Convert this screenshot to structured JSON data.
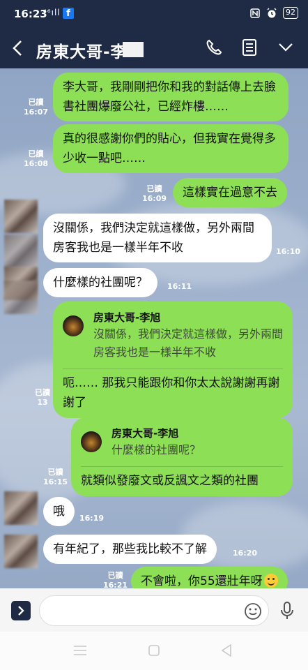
{
  "status_bar": {
    "time": "16:23",
    "signal": "⁴⁶ıll",
    "battery": "92",
    "icons": [
      "facebook-icon",
      "nfc-icon",
      "alarm-icon",
      "battery-icon"
    ]
  },
  "header": {
    "title": "房東大哥-李",
    "icons": [
      "back-arrow-icon",
      "phone-icon",
      "notes-icon",
      "chevron-down-icon"
    ],
    "background": "#1f2b45"
  },
  "chat": {
    "background": "#9db0cc",
    "outgoing_color": "#8de055",
    "incoming_color": "#ffffff",
    "messages": [
      {
        "dir": "out",
        "text": "李大哥，我剛剛把你和我的對話傳上去臉書社團爆廢公社，已經炸樓……",
        "read": "已讀",
        "time": "16:07"
      },
      {
        "dir": "out",
        "text": "真的很感謝你們的貼心，但我實在覺得多少收一點吧……",
        "read": "已讀",
        "time": "16:08"
      },
      {
        "dir": "out",
        "text": "這樣實在過意不去",
        "read": "已讀",
        "time": "16:09"
      },
      {
        "dir": "in",
        "text": "沒關係，我們決定就這樣做，另外兩間房客我也是一樣半年不收",
        "time": "16:10"
      },
      {
        "dir": "in",
        "text": "什麼樣的社團呢？",
        "time": "16:11"
      },
      {
        "dir": "out",
        "quote_name": "房東大哥-李旭",
        "quote_text": "沒關係，我們決定就這樣做，另外兩間房客我也是一樣半年不收",
        "text": "呃…… 那我只能跟你和你太太說謝謝再謝謝了",
        "read": "已讀",
        "time": "13"
      },
      {
        "dir": "out",
        "quote_name": "房東大哥-李旭",
        "quote_text": "什麼樣的社團呢？",
        "text": "就類似發廢文或反諷文之類的社團",
        "read": "已讀",
        "time": "16:15"
      },
      {
        "dir": "in",
        "text": "哦",
        "time": "16:19"
      },
      {
        "dir": "in",
        "text": "有年紀了，那些我比較不了解",
        "time": "16:20"
      },
      {
        "dir": "out",
        "text": "不會啦，你55還壯年呀",
        "emoji": "smiling-face-icon",
        "read": "已讀",
        "time": "16:21"
      }
    ]
  },
  "input": {
    "placeholder": "",
    "icons": [
      "expand-icon",
      "emoji-icon",
      "microphone-icon"
    ]
  },
  "nav_bar": {
    "icons": [
      "recent-apps-icon",
      "home-icon",
      "back-icon"
    ]
  }
}
